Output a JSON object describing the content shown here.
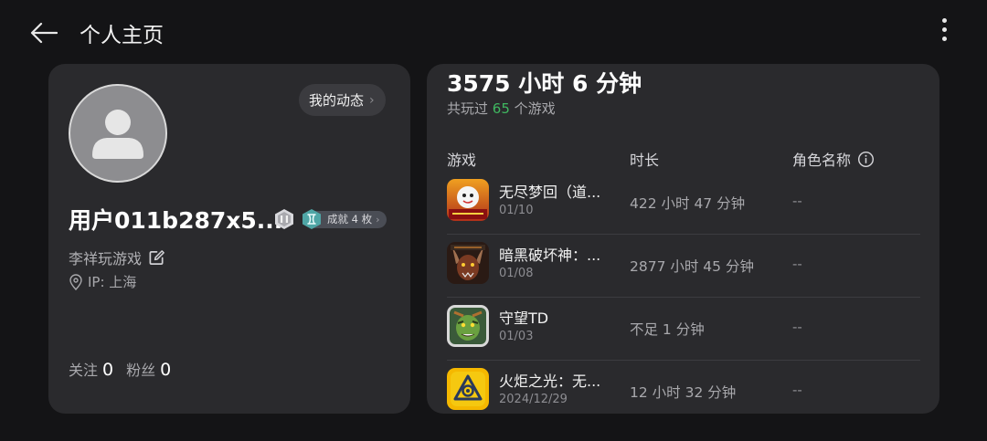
{
  "header": {
    "back_icon": "arrow-left-icon",
    "title": "个人主页",
    "more_icon": "more-vertical-icon"
  },
  "profile": {
    "avatar_icon": "default-user-avatar",
    "feed_button": {
      "label": "我的动态",
      "chevron": "›"
    },
    "username": "用户011b287x5...",
    "level_badge_icon": "level-badge-icon",
    "achievements": {
      "label": "成就 4 枚",
      "chevron": "›"
    },
    "bio": "李祥玩游戏",
    "ip": "IP: 上海",
    "following": {
      "label": "关注",
      "value": "0"
    },
    "followers": {
      "label": "粉丝",
      "value": "0"
    }
  },
  "stats": {
    "total_time": "3575 小时 6 分钟",
    "games_played": {
      "prefix": "共玩过",
      "count": "65",
      "suffix": "个游戏"
    },
    "columns": {
      "game": "游戏",
      "duration": "时长",
      "role": "角色名称"
    },
    "games": [
      {
        "name": "无尽梦回（道...",
        "date": "01/10",
        "duration": "422 小时 47 分钟",
        "role": "--"
      },
      {
        "name": "暗黑破坏神：...",
        "date": "01/08",
        "duration": "2877 小时 45 分钟",
        "role": "--"
      },
      {
        "name": "守望TD",
        "date": "01/03",
        "duration": "不足 1 分钟",
        "role": "--"
      },
      {
        "name": "火炬之光：无...",
        "date": "2024/12/29",
        "duration": "12 小时 32 分钟",
        "role": "--"
      }
    ]
  },
  "colors": {
    "background": "#141416",
    "card": "#2a2a2d",
    "accent_green": "#3fb760"
  }
}
